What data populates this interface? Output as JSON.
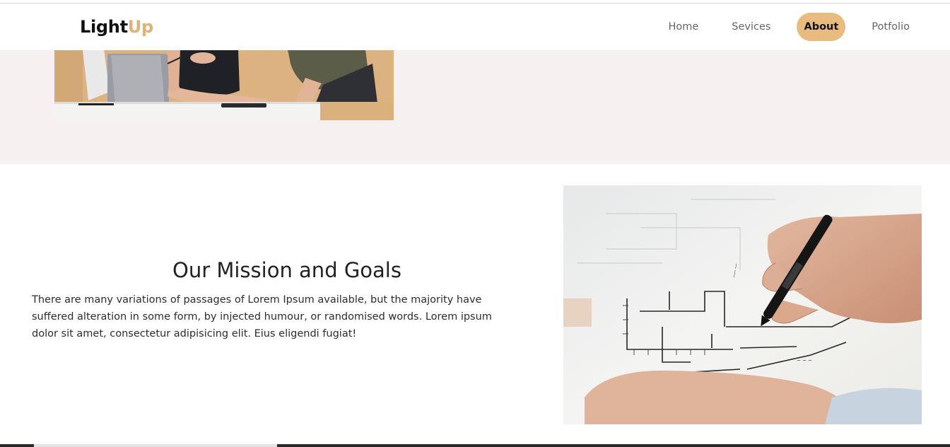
{
  "brand": {
    "name_part1": "Light",
    "name_part2": "Up",
    "accent_color": "#e0b27a"
  },
  "nav": {
    "items": [
      {
        "label": "Home",
        "active": false
      },
      {
        "label": "Sevices",
        "active": false
      },
      {
        "label": "About",
        "active": true
      },
      {
        "label": "Potfolio",
        "active": false
      }
    ],
    "active_color": "#e8bb7e"
  },
  "mission": {
    "title": "Our Mission and Goals",
    "text": "There are many variations of passages of Lorem Ipsum available, but the majority have suffered alteration in some form, by injected humour, or randomised words. Lorem ipsum dolor sit amet, consectetur adipisicing elit. Eius eligendi fugiat!"
  },
  "images": {
    "top": "team-meeting-photo",
    "side": "architect-drawing-blueprint-photo"
  },
  "colors": {
    "band_background": "#f6f0f0",
    "heading": "#1f2328"
  }
}
